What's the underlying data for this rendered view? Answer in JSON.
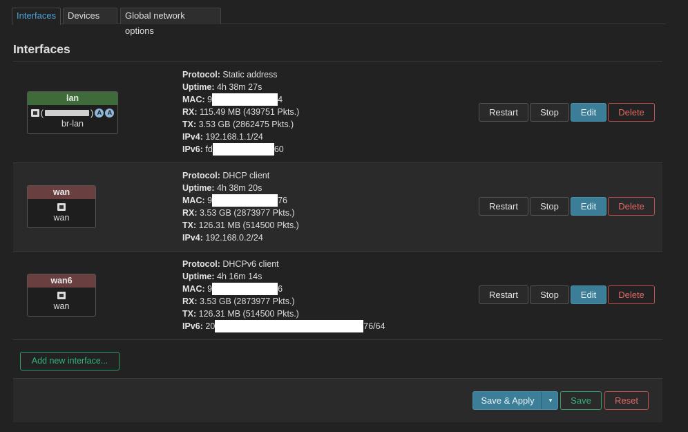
{
  "tabs": [
    {
      "label": "Interfaces",
      "active": true
    },
    {
      "label": "Devices",
      "active": false
    },
    {
      "label": "Global network options",
      "active": false
    }
  ],
  "section_title": "Interfaces",
  "labels": {
    "protocol": "Protocol:",
    "uptime": "Uptime:",
    "mac": "MAC:",
    "rx": "RX:",
    "tx": "TX:",
    "ipv4": "IPv4:",
    "ipv6": "IPv6:"
  },
  "interfaces": [
    {
      "name": "lan",
      "device": "br-lan",
      "protocol": "Static address",
      "uptime": "4h 38m 27s",
      "mac_prefix": "9",
      "mac_suffix": "4",
      "rx": "115.49 MB (439751 Pkts.)",
      "tx": "3.53 GB (2862475 Pkts.)",
      "ipv4": "192.168.1.1/24",
      "ipv6_prefix": "fd",
      "ipv6_suffix": "60"
    },
    {
      "name": "wan",
      "device": "wan",
      "protocol": "DHCP client",
      "uptime": "4h 38m 20s",
      "mac_prefix": "9",
      "mac_suffix": "76",
      "rx": "3.53 GB (2873977 Pkts.)",
      "tx": "126.31 MB (514500 Pkts.)",
      "ipv4": "192.168.0.2/24"
    },
    {
      "name": "wan6",
      "device": "wan",
      "protocol": "DHCPv6 client",
      "uptime": "4h 16m 14s",
      "mac_prefix": "9",
      "mac_suffix": "6",
      "rx": "3.53 GB (2873977 Pkts.)",
      "tx": "126.31 MB (514500 Pkts.)",
      "ipv6_prefix": "20",
      "ipv6_suffix": "76/64"
    }
  ],
  "buttons": {
    "restart": "Restart",
    "stop": "Stop",
    "edit": "Edit",
    "delete": "Delete",
    "add_interface": "Add new interface...",
    "save_apply": "Save & Apply",
    "save": "Save",
    "reset": "Reset"
  },
  "colors": {
    "accent": "#4fa3d6",
    "lan_zone": "#3f6a3a",
    "wan_zone": "#6a3f3f",
    "edit_button": "#3c7e98",
    "delete_button": "#c0504d",
    "save_button": "#2f9f6b"
  }
}
